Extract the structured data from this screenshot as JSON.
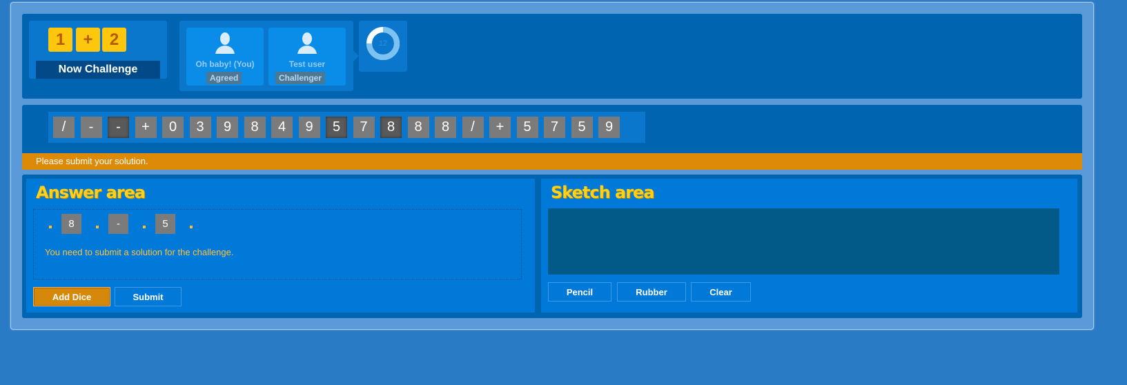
{
  "challenge": {
    "dice": [
      "1",
      "+",
      "2"
    ],
    "label": "Now Challenge"
  },
  "players": [
    {
      "name": "Oh baby! (You)",
      "status": "Agreed"
    },
    {
      "name": "Test user",
      "status": "Challenger"
    }
  ],
  "timer": {
    "value": "12",
    "progress": 0.75
  },
  "dice_row": [
    {
      "v": "/",
      "dark": false
    },
    {
      "v": "-",
      "dark": false
    },
    {
      "v": "-",
      "dark": true
    },
    {
      "v": "+",
      "dark": false
    },
    {
      "v": "0",
      "dark": false
    },
    {
      "v": "3",
      "dark": false
    },
    {
      "v": "9",
      "dark": false
    },
    {
      "v": "8",
      "dark": false
    },
    {
      "v": "4",
      "dark": false
    },
    {
      "v": "9",
      "dark": false
    },
    {
      "v": "5",
      "dark": true
    },
    {
      "v": "7",
      "dark": false
    },
    {
      "v": "8",
      "dark": true
    },
    {
      "v": "8",
      "dark": false
    },
    {
      "v": "8",
      "dark": false
    },
    {
      "v": "/",
      "dark": false
    },
    {
      "v": "+",
      "dark": false
    },
    {
      "v": "5",
      "dark": false
    },
    {
      "v": "7",
      "dark": false
    },
    {
      "v": "5",
      "dark": false
    },
    {
      "v": "9",
      "dark": false
    }
  ],
  "message": "Please submit your solution.",
  "answer": {
    "title": "Answer area",
    "dice": [
      "8",
      "-",
      "5"
    ],
    "hint": "You need to submit a solution for the challenge.",
    "add_dice_label": "Add Dice",
    "submit_label": "Submit"
  },
  "sketch": {
    "title": "Sketch area",
    "pencil_label": "Pencil",
    "rubber_label": "Rubber",
    "clear_label": "Clear"
  },
  "colors": {
    "background": "#2a7bc6",
    "panel": "#0164b1",
    "die_yellow": "#fdc70e",
    "die_grey": "#7b7b7b",
    "message_bar": "#dd8a08",
    "title_yellow": "#ffd21a"
  }
}
